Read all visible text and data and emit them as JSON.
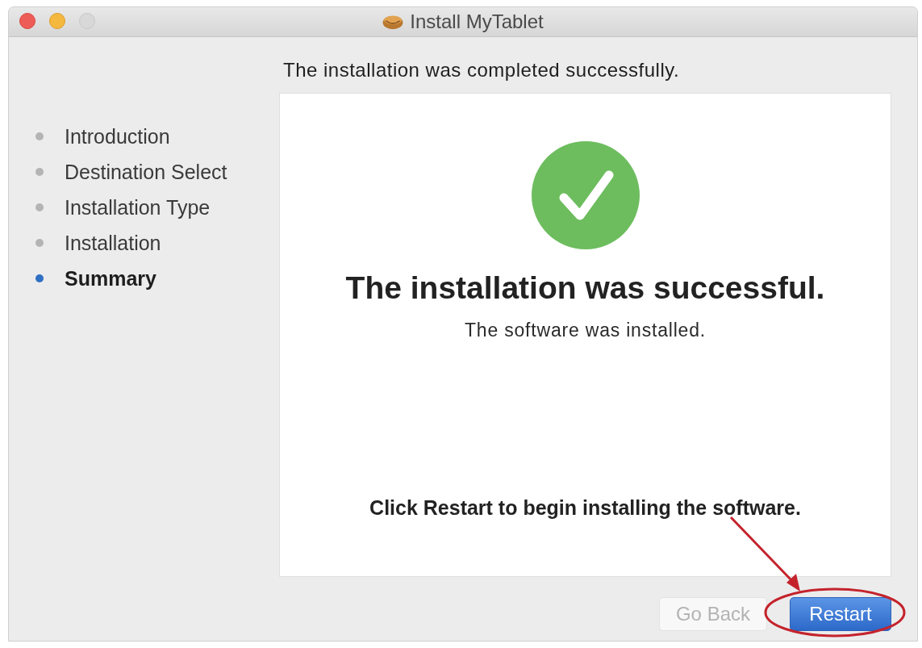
{
  "window": {
    "title": "Install MyTablet"
  },
  "steps": [
    {
      "label": "Introduction",
      "selected": false
    },
    {
      "label": "Destination Select",
      "selected": false
    },
    {
      "label": "Installation Type",
      "selected": false
    },
    {
      "label": "Installation",
      "selected": false
    },
    {
      "label": "Summary",
      "selected": true
    }
  ],
  "header": "The installation was completed successfully.",
  "panel": {
    "heading": "The installation was successful.",
    "message": "The software was installed.",
    "instruction": "Click Restart to begin installing the software."
  },
  "buttons": [
    {
      "label": "Go Back",
      "disabled": true,
      "default": false
    },
    {
      "label": "Restart",
      "disabled": false,
      "default": true
    }
  ]
}
